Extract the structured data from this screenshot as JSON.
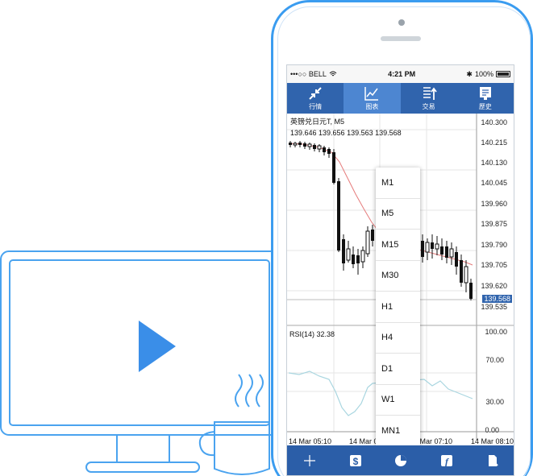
{
  "status_bar": {
    "carrier": "•••○○ BELL",
    "time": "4:21 PM",
    "battery": "100%"
  },
  "top_tabs": [
    {
      "label": "行情",
      "icon": "arrows-icon"
    },
    {
      "label": "图表",
      "icon": "chart-line-icon"
    },
    {
      "label": "交易",
      "icon": "trade-icon"
    },
    {
      "label": "歷史",
      "icon": "history-icon"
    }
  ],
  "chart": {
    "symbol_line": "英镑兑日元T, M5",
    "ohlc_line": "139.646 139.656 139.563 139.568",
    "current_price": "139.568",
    "price_labels": [
      "140.300",
      "140.215",
      "140.130",
      "140.045",
      "139.960",
      "139.875",
      "139.790",
      "139.705",
      "139.620",
      "139.535"
    ],
    "rsi_label": "RSI(14) 32.38",
    "rsi_levels": [
      "100.00",
      "70.00",
      "30.00",
      "0.00"
    ],
    "time_labels": [
      "14 Mar 05:10",
      "14 Mar 06:10",
      "14 Mar 07:10",
      "14 Mar 08:10"
    ]
  },
  "timeframe_menu": [
    "M1",
    "M5",
    "M15",
    "M30",
    "H1",
    "H4",
    "D1",
    "W1",
    "MN1"
  ],
  "bottom_bar": [
    {
      "icon": "crosshair-icon"
    },
    {
      "icon": "dollar-icon"
    },
    {
      "icon": "pie-icon"
    },
    {
      "icon": "function-icon"
    },
    {
      "icon": "document-icon"
    }
  ],
  "colors": {
    "accent": "#3a9cf0",
    "toolbar": "#3064ad",
    "play": "#3a8ee8"
  }
}
